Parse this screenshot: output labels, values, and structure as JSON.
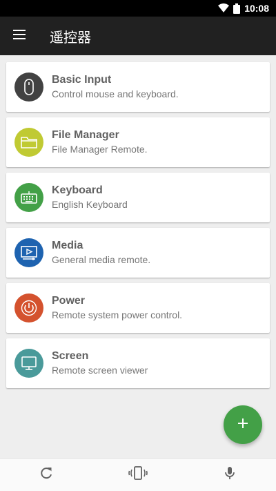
{
  "status_bar": {
    "time": "10:08",
    "icons": [
      "wifi-icon",
      "battery-icon"
    ]
  },
  "app_bar": {
    "title": "遥控器",
    "menu_icon": "menu-icon"
  },
  "remotes": [
    {
      "title": "Basic Input",
      "subtitle": "Control mouse and keyboard.",
      "icon": "mouse-icon",
      "color": "#424242"
    },
    {
      "title": "File Manager",
      "subtitle": "File Manager Remote.",
      "icon": "folder-icon",
      "color": "#c0ca33"
    },
    {
      "title": "Keyboard",
      "subtitle": "English Keyboard",
      "icon": "keyboard-icon",
      "color": "#43a047"
    },
    {
      "title": "Media",
      "subtitle": "General media remote.",
      "icon": "media-icon",
      "color": "#1e63b0"
    },
    {
      "title": "Power",
      "subtitle": "Remote system power control.",
      "icon": "power-icon",
      "color": "#d4522e"
    },
    {
      "title": "Screen",
      "subtitle": "Remote screen viewer",
      "icon": "monitor-icon",
      "color": "#4a9a9a"
    }
  ],
  "fab": {
    "icon": "plus-icon",
    "color": "#43a047"
  },
  "bottom_bar": {
    "icons": [
      "refresh-icon",
      "vibrate-icon",
      "microphone-icon"
    ]
  }
}
